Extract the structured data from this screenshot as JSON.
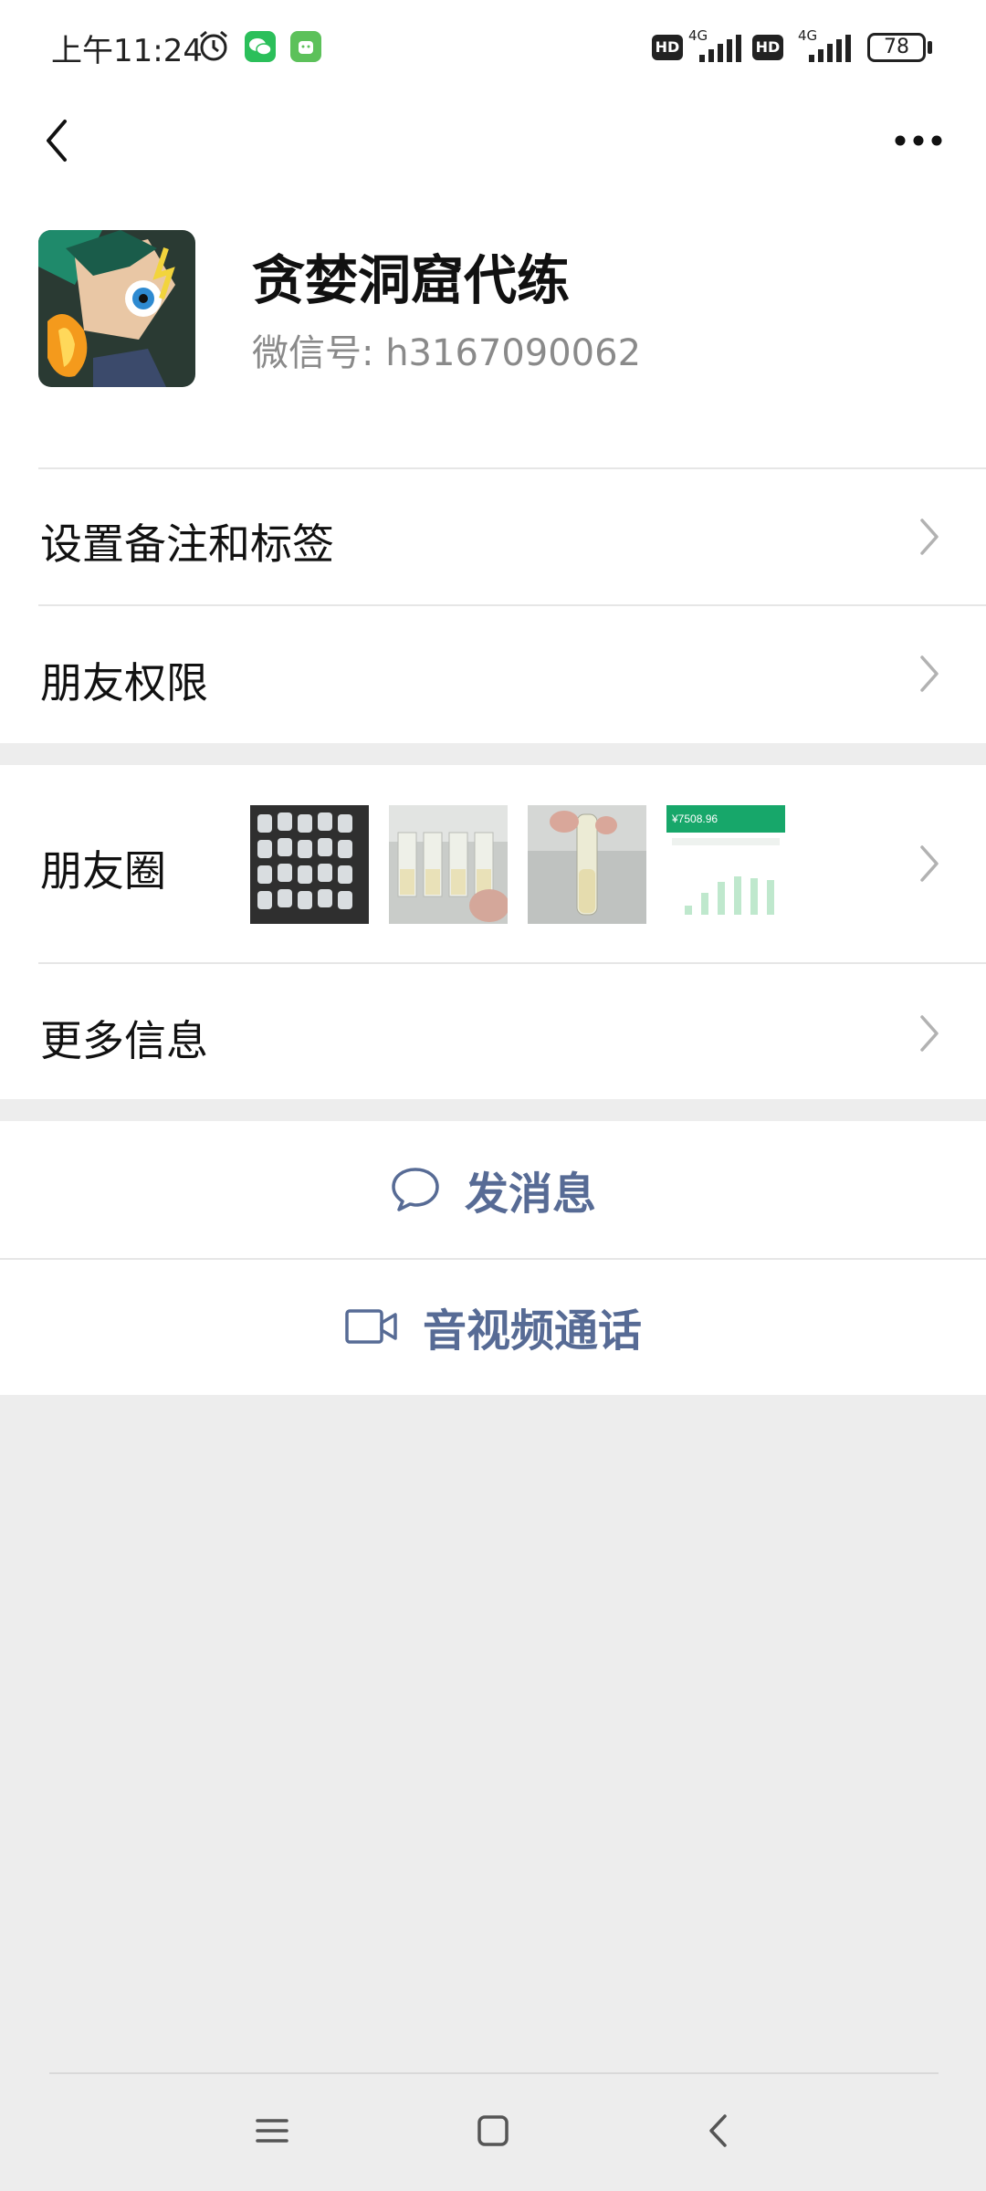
{
  "status_bar": {
    "time": "上午11:24",
    "hd1": "HD",
    "net1": "4G",
    "hd2": "HD",
    "net2": "4G",
    "battery": "78"
  },
  "profile": {
    "name": "贪婪洞窟代练",
    "wechat_id": "微信号: h3167090062"
  },
  "menu": {
    "remark_tags": "设置备注和标签",
    "friend_permissions": "朋友权限",
    "moments": "朋友圈",
    "more_info": "更多信息"
  },
  "moments_thumb_text": "¥7508.96",
  "actions": {
    "send_message": "发消息",
    "av_call": "音视频通话"
  },
  "colors": {
    "link_blue": "#576b95",
    "wechat_green": "#2bbf5a"
  }
}
